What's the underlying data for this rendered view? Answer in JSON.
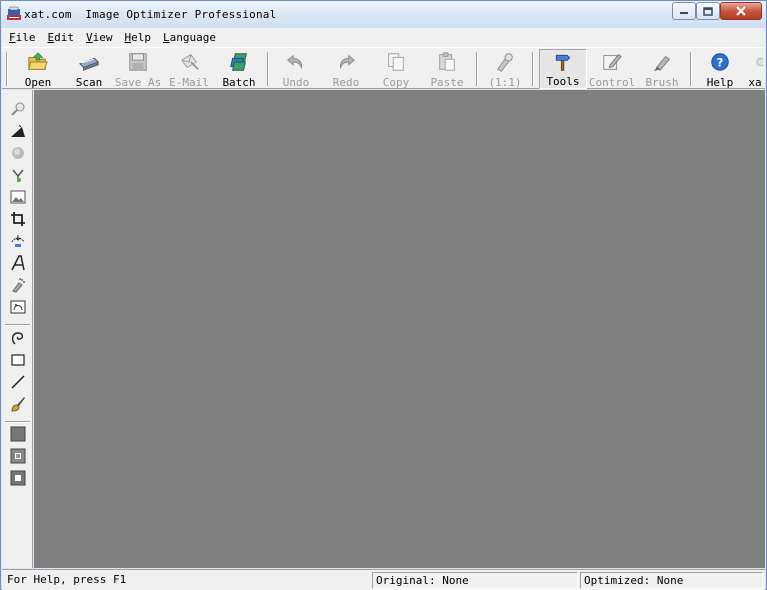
{
  "window": {
    "title": "xat.com  Image Optimizer Professional"
  },
  "menu": [
    {
      "prefix": "",
      "accel": "F",
      "rest": "ile"
    },
    {
      "prefix": "",
      "accel": "E",
      "rest": "dit"
    },
    {
      "prefix": "",
      "accel": "V",
      "rest": "iew"
    },
    {
      "prefix": "",
      "accel": "H",
      "rest": "elp"
    },
    {
      "prefix": "",
      "accel": "L",
      "rest": "anguage"
    }
  ],
  "toolbar": {
    "open": "Open",
    "scan": "Scan",
    "save_as": "Save As",
    "email": "E-Mail",
    "batch": "Batch",
    "undo": "Undo",
    "redo": "Redo",
    "copy": "Copy",
    "paste": "Paste",
    "zoom": "(1:1)",
    "tools": "Tools",
    "control": "Control",
    "brush": "Brush",
    "help": "Help",
    "xa": "xa"
  },
  "tools": [
    "zoom-tool-icon",
    "sharpen-tool-icon",
    "blur-tool-icon",
    "pipette-tool-icon",
    "image-tool-icon",
    "crop-tool-icon",
    "rotate-tool-icon",
    "text-tool-icon",
    "spray-tool-icon",
    "transform-tool-icon",
    "lasso-tool-icon",
    "rectangle-tool-icon",
    "line-tool-icon",
    "paint-brush-tool-icon",
    "fill-solid-icon",
    "fill-pattern-icon",
    "fill-mask-icon"
  ],
  "status": {
    "help": "For Help, press F1",
    "original": "Original: None",
    "optimized": "Optimized: None"
  },
  "colors": {
    "canvas": "#808080",
    "chrome": "#f0f0f0",
    "accent_blue": "#1f5fbf"
  }
}
